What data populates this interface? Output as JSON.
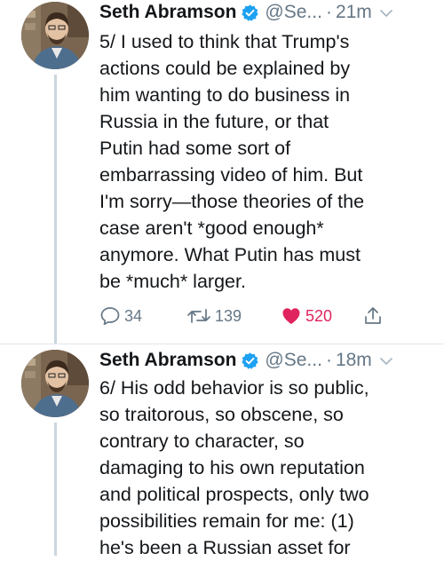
{
  "tweets": [
    {
      "author_name": "Seth Abramson",
      "handle": "@Se...",
      "separator": "·",
      "time": "21m",
      "text_lines": [
        "5/ I used to think that Trump's",
        "actions could be explained by",
        "him wanting to do business in",
        "Russia in the future, or that",
        "Putin had some sort of",
        "embarrassing video of him. But",
        "I'm sorry—those theories of the",
        "case aren't *good enough*",
        "anymore. What Putin has must",
        "be *much* larger."
      ],
      "reply_count": "34",
      "retweet_count": "139",
      "like_count": "520"
    },
    {
      "author_name": "Seth Abramson",
      "handle": "@Se...",
      "separator": "·",
      "time": "18m",
      "text_lines": [
        "6/ His odd behavior is so public,",
        "so traitorous, so obscene, so",
        "contrary to character, so",
        "damaging to his own reputation",
        "and political prospects, only two",
        "possibilities remain for me: (1)",
        "he's been a Russian asset for"
      ]
    }
  ],
  "colors": {
    "text": "#14171a",
    "secondary": "#657786",
    "verified": "#1da1f2",
    "like": "#e0245e",
    "thread_line": "#ccd6dd"
  },
  "icons": {
    "verified": "verified-badge-icon",
    "chevron": "chevron-down-icon",
    "reply": "reply-icon",
    "retweet": "retweet-icon",
    "like": "heart-icon",
    "share": "share-icon"
  }
}
